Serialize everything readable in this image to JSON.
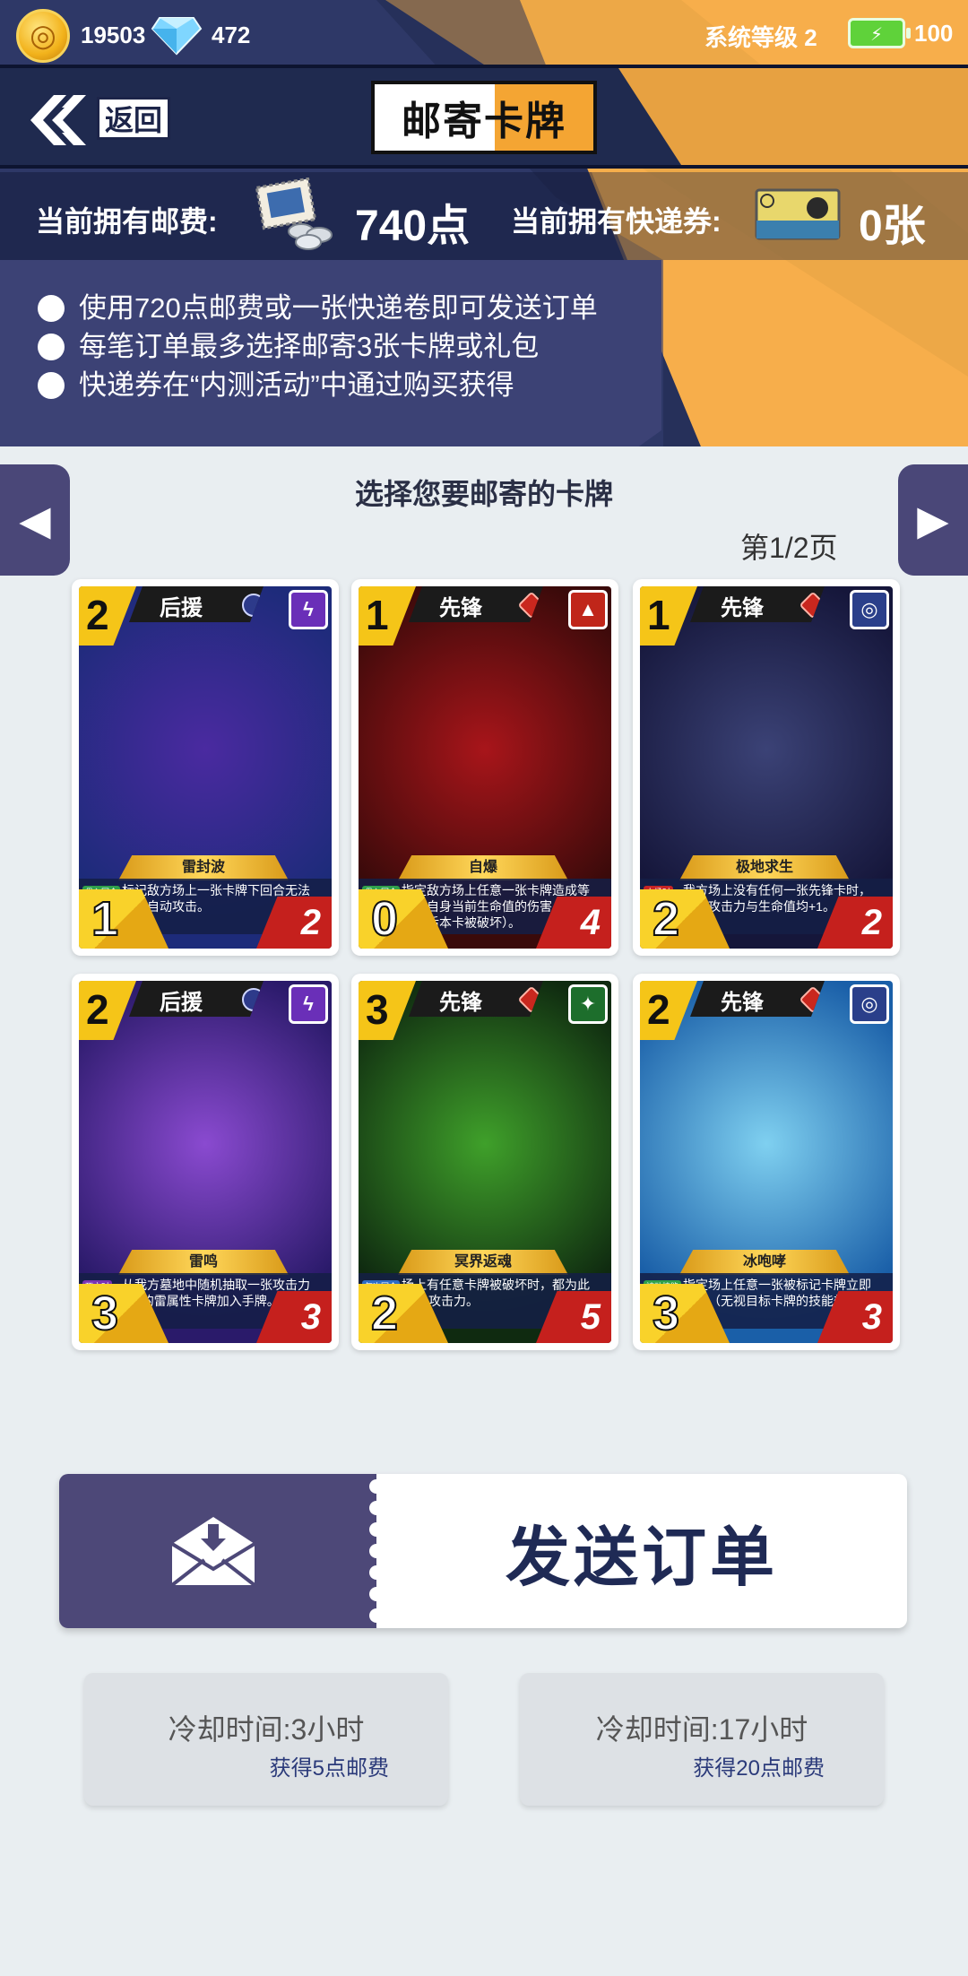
{
  "status": {
    "gold": "19503",
    "gems": "472",
    "system_level": "系统等级 2",
    "energy": "100"
  },
  "header": {
    "back_label": "返回",
    "title": "邮寄卡牌"
  },
  "currency": {
    "postage_label": "当前拥有邮费:",
    "postage_value": "740点",
    "voucher_label": "当前拥有快递券:",
    "voucher_value": "0张"
  },
  "info": [
    "使用720点邮费或一张快递卷即可发送订单",
    "每笔订单最多选择邮寄3张卡牌或礼包",
    "快递券在“内测活动”中通过购买获得"
  ],
  "select_title": "选择您要邮寄的卡牌",
  "page_indicator": "第1/2页",
  "cards": [
    {
      "cost": "2",
      "role": "后援",
      "name": "雷封波",
      "tag": "贯入回合",
      "desc": "标记敌方场上一张卡牌下回合无法进行自动攻击。",
      "attack": "1",
      "hp": "2",
      "element": "purple",
      "colors": [
        "#1d2b7a",
        "#4a2aa0"
      ]
    },
    {
      "cost": "1",
      "role": "先锋",
      "name": "自爆",
      "tag": "贯入回合",
      "desc": "指定敌方场上任意一张卡牌造成等同于自身当前生命值的伤害（发动技能后本卡被破坏）。",
      "attack": "0",
      "hp": "4",
      "element": "red",
      "colors": [
        "#3a0a0a",
        "#a8151a"
      ]
    },
    {
      "cost": "1",
      "role": "先锋",
      "name": "极地求生",
      "tag": "上场时",
      "desc": "我方场上没有任何一张先锋卡时，此卡攻击力与生命值均+1。",
      "attack": "2",
      "hp": "2",
      "element": "blue",
      "colors": [
        "#15163a",
        "#3b4276"
      ]
    },
    {
      "cost": "2",
      "role": "后援",
      "name": "雷鸣",
      "tag": "死亡时",
      "desc": "从我方墓地中随机抽取一张攻击力为1的雷属性卡牌加入手牌。",
      "attack": "3",
      "hp": "3",
      "element": "purple",
      "colors": [
        "#2a1a6a",
        "#8a4ad0"
      ]
    },
    {
      "cost": "3",
      "role": "先锋",
      "name": "冥界返魂",
      "tag": "每次回合",
      "desc": "场上有任意卡牌被破坏时，都为此卡+1攻击力。",
      "attack": "2",
      "hp": "5",
      "element": "green",
      "colors": [
        "#0f2a10",
        "#3fa02a"
      ]
    },
    {
      "cost": "2",
      "role": "先锋",
      "name": "冰咆哮",
      "tag": "被动技能",
      "desc": "指定场上任意一张被标记卡牌立即破坏（无视目标卡牌的技能效果）",
      "attack": "3",
      "hp": "3",
      "element": "blue",
      "colors": [
        "#1a5fa8",
        "#7fd0f0"
      ]
    }
  ],
  "send_button": "发送订单",
  "cooldowns": [
    {
      "time": "冷却时间:3小时",
      "reward": "获得5点邮费"
    },
    {
      "time": "冷却时间:17小时",
      "reward": "获得20点邮费"
    }
  ],
  "colors": {
    "navy": "#26305a",
    "orange": "#f7ae4b",
    "panel_purple": "#4a4778",
    "background": "#e9eef1"
  },
  "icons": [
    "gold-coin-icon",
    "diamond-icon",
    "battery-icon",
    "back-arrow-icon",
    "postage-stamp-icon",
    "express-voucher-icon",
    "envelope-icon",
    "chevron-left-icon",
    "chevron-right-icon"
  ]
}
